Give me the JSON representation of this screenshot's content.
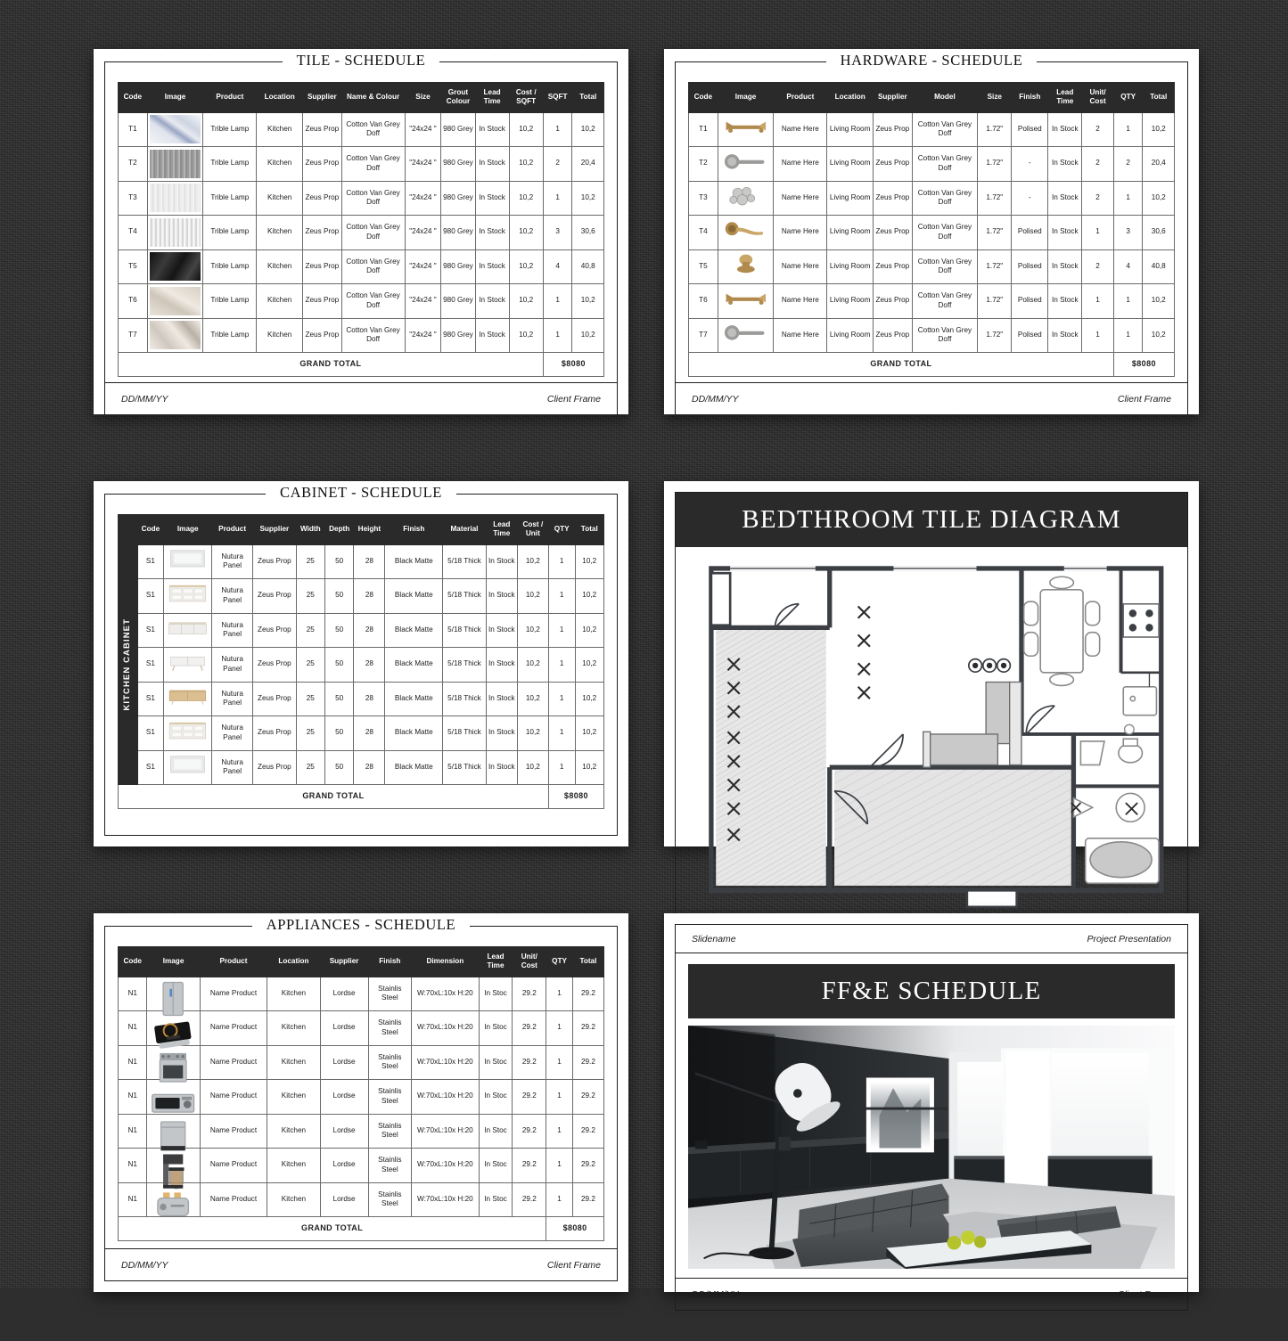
{
  "background_color": "#2e2e2e",
  "accent_dark": "#2a2a2a",
  "footer": {
    "date": "DD/MM/YY",
    "client": "Client Frame"
  },
  "tile_sheet": {
    "title": "TILE - SCHEDULE",
    "columns": [
      "Code",
      "Image",
      "Product",
      "Location",
      "Supplier",
      "Name & Colour",
      "Size",
      "Grout Colour",
      "Lead Time",
      "Cost / SQFT",
      "SQFT",
      "Total"
    ],
    "rows": [
      {
        "code": "T1",
        "image": "tile-marble-blue-veined",
        "product": "Trible Lamp",
        "location": "Kitchen",
        "supplier": "Zeus Prop",
        "name_colour": "Cotton Van Grey Doff",
        "size": "\"24x24 \"",
        "grout": "980 Grey",
        "lead": "In Stock",
        "cost": "10,2",
        "sqft": "1",
        "total": "10,2"
      },
      {
        "code": "T2",
        "image": "tile-brushed-grey",
        "product": "Trible Lamp",
        "location": "Kitchen",
        "supplier": "Zeus Prop",
        "name_colour": "Cotton Van Grey Doff",
        "size": "\"24x24 \"",
        "grout": "980 Grey",
        "lead": "In Stock",
        "cost": "10,2",
        "sqft": "2",
        "total": "20,4"
      },
      {
        "code": "T3",
        "image": "tile-white-linen",
        "product": "Trible Lamp",
        "location": "Kitchen",
        "supplier": "Zeus Prop",
        "name_colour": "Cotton Van Grey Doff",
        "size": "\"24x24 \"",
        "grout": "980 Grey",
        "lead": "In Stock",
        "cost": "10,2",
        "sqft": "1",
        "total": "10,2"
      },
      {
        "code": "T4",
        "image": "tile-white-striated",
        "product": "Trible Lamp",
        "location": "Kitchen",
        "supplier": "Zeus Prop",
        "name_colour": "Cotton Van Grey Doff",
        "size": "\"24x24 \"",
        "grout": "980 Grey",
        "lead": "In Stock",
        "cost": "10,2",
        "sqft": "3",
        "total": "30,6"
      },
      {
        "code": "T5",
        "image": "tile-black-slate",
        "product": "Trible Lamp",
        "location": "Kitchen",
        "supplier": "Zeus Prop",
        "name_colour": "Cotton Van Grey Doff",
        "size": "\"24x24 \"",
        "grout": "980 Grey",
        "lead": "In Stock",
        "cost": "10,2",
        "sqft": "4",
        "total": "40,8"
      },
      {
        "code": "T6",
        "image": "tile-beige-travertine",
        "product": "Trible Lamp",
        "location": "Kitchen",
        "supplier": "Zeus Prop",
        "name_colour": "Cotton Van Grey Doff",
        "size": "\"24x24 \"",
        "grout": "980 Grey",
        "lead": "In Stock",
        "cost": "10,2",
        "sqft": "1",
        "total": "10,2"
      },
      {
        "code": "T7",
        "image": "tile-cream-onyx",
        "product": "Trible Lamp",
        "location": "Kitchen",
        "supplier": "Zeus Prop",
        "name_colour": "Cotton Van Grey Doff",
        "size": "\"24x24 \"",
        "grout": "980 Grey",
        "lead": "In Stock",
        "cost": "10,2",
        "sqft": "1",
        "total": "10,2"
      }
    ],
    "grand_total_label": "GRAND TOTAL",
    "grand_total_value": "$8080"
  },
  "hardware_sheet": {
    "title": "HARDWARE - SCHEDULE",
    "columns": [
      "Code",
      "Image",
      "Product",
      "Location",
      "Supplier",
      "Model",
      "Size",
      "Finish",
      "Lead Time",
      "Unit/ Cost",
      "QTY",
      "Total"
    ],
    "rows": [
      {
        "code": "T1",
        "image": "brass-pull-handle",
        "product": "Name Here",
        "location": "Living Room",
        "supplier": "Zeus Prop",
        "model": "Cotton Van Grey Doff",
        "size": "1.72\"",
        "finish": "Polised",
        "lead": "In Stock",
        "unit": "2",
        "qty": "1",
        "total": "10,2"
      },
      {
        "code": "T2",
        "image": "nickel-lever-handle",
        "product": "Name Here",
        "location": "Living Room",
        "supplier": "Zeus Prop",
        "model": "Cotton Van Grey Doff",
        "size": "1.72\"",
        "finish": "-",
        "lead": "In Stock",
        "unit": "2",
        "qty": "2",
        "total": "20,4"
      },
      {
        "code": "T3",
        "image": "chrome-cluster-knob",
        "product": "Name Here",
        "location": "Living Room",
        "supplier": "Zeus Prop",
        "model": "Cotton Van Grey Doff",
        "size": "1.72\"",
        "finish": "-",
        "lead": "In Stock",
        "unit": "2",
        "qty": "1",
        "total": "10,2"
      },
      {
        "code": "T4",
        "image": "brass-curved-lever",
        "product": "Name Here",
        "location": "Living Room",
        "supplier": "Zeus Prop",
        "model": "Cotton Van Grey Doff",
        "size": "1.72\"",
        "finish": "Polised",
        "lead": "In Stock",
        "unit": "1",
        "qty": "3",
        "total": "30,6"
      },
      {
        "code": "T5",
        "image": "brass-round-knob",
        "product": "Name Here",
        "location": "Living Room",
        "supplier": "Zeus Prop",
        "model": "Cotton Van Grey Doff",
        "size": "1.72\"",
        "finish": "Polised",
        "lead": "In Stock",
        "unit": "2",
        "qty": "4",
        "total": "40,8"
      },
      {
        "code": "T6",
        "image": "brass-pull-handle",
        "product": "Name Here",
        "location": "Living Room",
        "supplier": "Zeus Prop",
        "model": "Cotton Van Grey Doff",
        "size": "1.72\"",
        "finish": "Polised",
        "lead": "In Stock",
        "unit": "1",
        "qty": "1",
        "total": "10,2"
      },
      {
        "code": "T7",
        "image": "nickel-lever-handle",
        "product": "Name Here",
        "location": "Living Room",
        "supplier": "Zeus Prop",
        "model": "Cotton Van Grey Doff",
        "size": "1.72\"",
        "finish": "Polised",
        "lead": "In Stock",
        "unit": "1",
        "qty": "1",
        "total": "10,2"
      }
    ],
    "grand_total_label": "GRAND TOTAL",
    "grand_total_value": "$8080"
  },
  "cabinet_sheet": {
    "title": "CABINET - SCHEDULE",
    "rail_label": "KITCHEN CABINET",
    "columns": [
      "Code",
      "Image",
      "Product",
      "Supplier",
      "Width",
      "Depth",
      "Height",
      "Finish",
      "Material",
      "Lead Time",
      "Cost / Unit",
      "QTY",
      "Total"
    ],
    "rows": [
      {
        "code": "S1",
        "image": "white-wall-cabinet",
        "product": "Nutura Panel",
        "supplier": "Zeus Prop",
        "width": "25",
        "depth": "50",
        "height": "28",
        "finish": "Black Matte",
        "material": "5/18 Thick",
        "lead": "In Stock",
        "cost": "10,2",
        "qty": "1",
        "total": "10,2"
      },
      {
        "code": "S1",
        "image": "white-dresser",
        "product": "Nutura Panel",
        "supplier": "Zeus Prop",
        "width": "25",
        "depth": "50",
        "height": "28",
        "finish": "Black Matte",
        "material": "5/18 Thick",
        "lead": "In Stock",
        "cost": "10,2",
        "qty": "1",
        "total": "10,2"
      },
      {
        "code": "S1",
        "image": "white-sideboard",
        "product": "Nutura Panel",
        "supplier": "Zeus Prop",
        "width": "25",
        "depth": "50",
        "height": "28",
        "finish": "Black Matte",
        "material": "5/18 Thick",
        "lead": "In Stock",
        "cost": "10,2",
        "qty": "1",
        "total": "10,2"
      },
      {
        "code": "S1",
        "image": "white-media-console",
        "product": "Nutura Panel",
        "supplier": "Zeus Prop",
        "width": "25",
        "depth": "50",
        "height": "28",
        "finish": "Black Matte",
        "material": "5/18 Thick",
        "lead": "In Stock",
        "cost": "10,2",
        "qty": "1",
        "total": "10,2"
      },
      {
        "code": "S1",
        "image": "oak-sideboard",
        "product": "Nutura Panel",
        "supplier": "Zeus Prop",
        "width": "25",
        "depth": "50",
        "height": "28",
        "finish": "Black Matte",
        "material": "5/18 Thick",
        "lead": "In Stock",
        "cost": "10,2",
        "qty": "1",
        "total": "10,2"
      },
      {
        "code": "S1",
        "image": "white-dresser",
        "product": "Nutura Panel",
        "supplier": "Zeus Prop",
        "width": "25",
        "depth": "50",
        "height": "28",
        "finish": "Black Matte",
        "material": "5/18 Thick",
        "lead": "In Stock",
        "cost": "10,2",
        "qty": "1",
        "total": "10,2"
      },
      {
        "code": "S1",
        "image": "white-wall-cabinet",
        "product": "Nutura Panel",
        "supplier": "Zeus Prop",
        "width": "25",
        "depth": "50",
        "height": "28",
        "finish": "Black Matte",
        "material": "5/18 Thick",
        "lead": "In Stock",
        "cost": "10,2",
        "qty": "1",
        "total": "10,2"
      }
    ],
    "grand_total_label": "GRAND TOTAL",
    "grand_total_value": "$8080"
  },
  "appliances_sheet": {
    "title": "APPLIANCES - SCHEDULE",
    "columns": [
      "Code",
      "Image",
      "Product",
      "Location",
      "Supplier",
      "Finish",
      "Dimension",
      "Lead Time",
      "Unit/ Cost",
      "QTY",
      "Total"
    ],
    "rows": [
      {
        "code": "N1",
        "image": "refrigerator",
        "product": "Name Product",
        "location": "Kitchen",
        "supplier": "Lordse",
        "finish": "Stainlis Steel",
        "dimension": "W:70xL:10x H:20",
        "lead": "In Stoc",
        "cost": "29.2",
        "qty": "1",
        "total": "29.2"
      },
      {
        "code": "N1",
        "image": "induction-cooktop",
        "product": "Name Product",
        "location": "Kitchen",
        "supplier": "Lordse",
        "finish": "Stainlis Steel",
        "dimension": "W:70xL:10x H:20",
        "lead": "In Stoc",
        "cost": "29.2",
        "qty": "1",
        "total": "29.2"
      },
      {
        "code": "N1",
        "image": "range-oven",
        "product": "Name Product",
        "location": "Kitchen",
        "supplier": "Lordse",
        "finish": "Stainlis Steel",
        "dimension": "W:70xL:10x H:20",
        "lead": "In Stoc",
        "cost": "29.2",
        "qty": "1",
        "total": "29.2"
      },
      {
        "code": "N1",
        "image": "microwave",
        "product": "Name Product",
        "location": "Kitchen",
        "supplier": "Lordse",
        "finish": "Stainlis Steel",
        "dimension": "W:70xL:10x H:20",
        "lead": "In Stoc",
        "cost": "29.2",
        "qty": "1",
        "total": "29.2"
      },
      {
        "code": "N1",
        "image": "dishwasher",
        "product": "Name Product",
        "location": "Kitchen",
        "supplier": "Lordse",
        "finish": "Stainlis Steel",
        "dimension": "W:70xL:10x H:20",
        "lead": "In Stoc",
        "cost": "29.2",
        "qty": "1",
        "total": "29.2"
      },
      {
        "code": "N1",
        "image": "coffee-maker",
        "product": "Name Product",
        "location": "Kitchen",
        "supplier": "Lordse",
        "finish": "Stainlis Steel",
        "dimension": "W:70xL:10x H:20",
        "lead": "In Stoc",
        "cost": "29.2",
        "qty": "1",
        "total": "29.2"
      },
      {
        "code": "N1",
        "image": "toaster",
        "product": "Name Product",
        "location": "Kitchen",
        "supplier": "Lordse",
        "finish": "Stainlis Steel",
        "dimension": "W:70xL:10x H:20",
        "lead": "In Stoc",
        "cost": "29.2",
        "qty": "1",
        "total": "29.2"
      }
    ],
    "grand_total_label": "GRAND TOTAL",
    "grand_total_value": "$8080"
  },
  "diagram_sheet": {
    "banner_title": "BEDTHROOM TILE DIAGRAM",
    "content": "architectural-floor-plan"
  },
  "ffe_sheet": {
    "slide_left": "Slidename",
    "slide_right": "Project Presentation",
    "banner_title": "FF&E SCHEDULE",
    "content": "monochrome-living-room-render"
  }
}
